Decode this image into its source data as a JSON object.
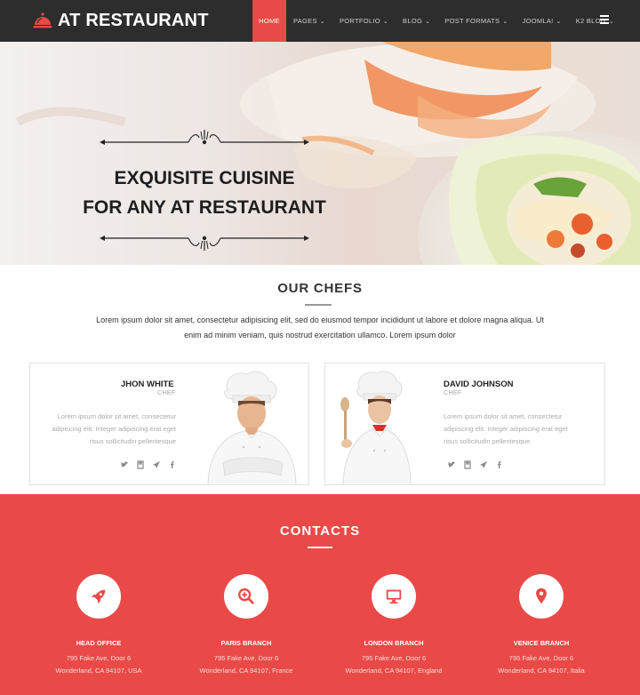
{
  "nav": {
    "logo_text": "AT RESTAURANT",
    "items": [
      {
        "label": "HOME",
        "active": true
      },
      {
        "label": "PAGES"
      },
      {
        "label": "PORTFOLIO"
      },
      {
        "label": "BLOG"
      },
      {
        "label": "POST FORMATS"
      },
      {
        "label": "JOOMLA!"
      },
      {
        "label": "K2 BLOG"
      }
    ]
  },
  "hero": {
    "line1": "EXQUISITE CUISINE",
    "line2": "FOR ANY AT RESTAURANT"
  },
  "chefs": {
    "title": "OUR CHEFS",
    "intro_line1": "Lorem ipsum dolor sit amet, consectetur adipisicing elit, sed do eiusmod tempor incididunt ut labore et dolore magna aliqua. Ut",
    "intro_line2": "enim ad minim veniam, quis nostrud exercitation ullamco.  Lorem ipsum dolor",
    "cards": [
      {
        "name": "JHON WHITE",
        "role": "CHEF",
        "text_line1": "Lorem ipsum dolor sit amet, consectetur",
        "text_line2": "adipiscing elit. Integer adipiscing erat eget",
        "text_line3": "risus sollicitudin pellentesque"
      },
      {
        "name": "DAVID JOHNSON",
        "role": "CHEF",
        "text_line1": "Lorem ipsum dolor sit amet, consectetur",
        "text_line2": "adipiscing elit. Integer adipiscing erat eget",
        "text_line3": "risus sollicitudin pellentesque"
      }
    ]
  },
  "contacts": {
    "title": "CONTACTS",
    "branches": [
      {
        "name": "HEAD OFFICE",
        "addr1": "795 Fake Ave, Door 6",
        "addr2": "Wonderland, CA 94107, USA",
        "icon": "rocket-icon"
      },
      {
        "name": "PARIS BRANCH",
        "addr1": "795 Fake Ave, Door 6",
        "addr2": "Wonderland, CA 94107, France",
        "icon": "search-plus-icon"
      },
      {
        "name": "LONDON BRANCH",
        "addr1": "795 Fake Ave, Door 6",
        "addr2": "Wonderland, CA 94107, England",
        "icon": "monitor-icon"
      },
      {
        "name": "VENICE BRANCH",
        "addr1": "795 Fake Ave, Door 6",
        "addr2": "Wonderland, CA 94107, Italia",
        "icon": "map-pin-icon"
      }
    ]
  },
  "colors": {
    "accent": "#e94a47",
    "nav_bg": "#2d2d2d"
  }
}
